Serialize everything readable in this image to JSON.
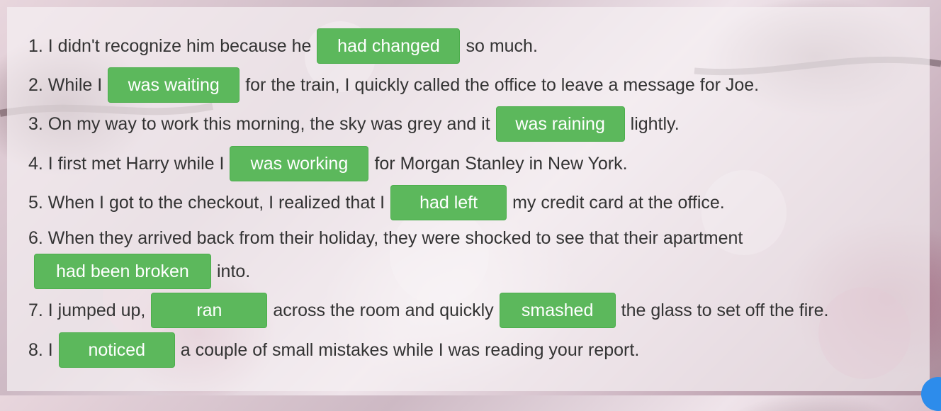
{
  "sentences": [
    {
      "pre": "1. I didn't recognize him because he",
      "gap": "had changed",
      "post": "so much."
    },
    {
      "pre": "2. While I",
      "gap": "was waiting",
      "post": "for the train, I quickly called the office to leave a message for Joe."
    },
    {
      "pre": "3. On my way to work this morning, the sky was grey and it",
      "gap": "was raining",
      "post": "lightly."
    },
    {
      "pre": "4. I first met Harry while I",
      "gap": "was working",
      "post": "for Morgan Stanley in New York."
    },
    {
      "pre": "5. When I got to the checkout, I realized that I",
      "gap": "had left",
      "post": "my credit card at the office."
    },
    {
      "line1": "6. When they arrived back from their holiday, they were shocked to see that their apartment",
      "gap": "had been broken",
      "post": "into."
    },
    {
      "pre": "7. I jumped up,",
      "gap1": "ran",
      "mid": "across the room and quickly",
      "gap2": "smashed",
      "post": "the glass to set off the fire."
    },
    {
      "pre": "8. I",
      "gap": "noticed",
      "post": "a couple of small mistakes while I was reading your report."
    }
  ],
  "colors": {
    "answer_bg": "#5cb85c",
    "answer_text": "#ffffff",
    "text": "#333333",
    "corner_button": "#2d8ceb"
  }
}
